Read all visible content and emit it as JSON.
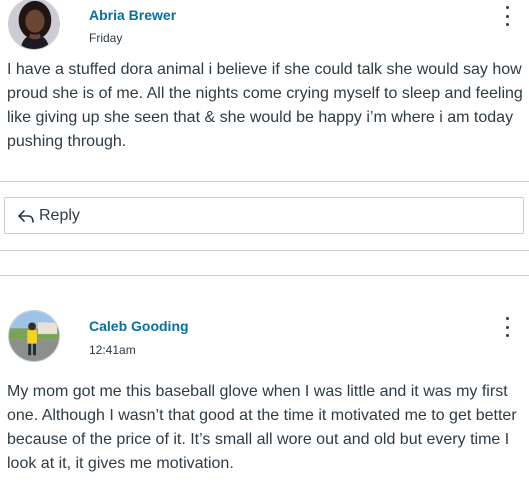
{
  "posts": [
    {
      "author": "Abria Brewer",
      "timestamp": "Friday",
      "message": "I have a stuffed dora animal i believe if she could talk she would say how proud she is of me. All the nights come crying myself to sleep and feeling like giving up she seen that & she would be happy i’m where i am today pushing through.",
      "avatar_icon": "user-photo"
    },
    {
      "author": "Caleb Gooding",
      "timestamp": "12:41am",
      "message": "My mom got me this baseball glove when I was little and it was my first one. Although I wasn’t that good at the time it motivated me to get better because of the price of it. It’s small all wore out and old but every time I look at it, it gives me motivation.",
      "avatar_icon": "user-photo"
    }
  ],
  "reply": {
    "label": "Reply",
    "icon": "reply-arrow-icon"
  },
  "colors": {
    "author_link": "#0770a3",
    "text": "#2d3b45",
    "border": "#c7cdd1"
  }
}
